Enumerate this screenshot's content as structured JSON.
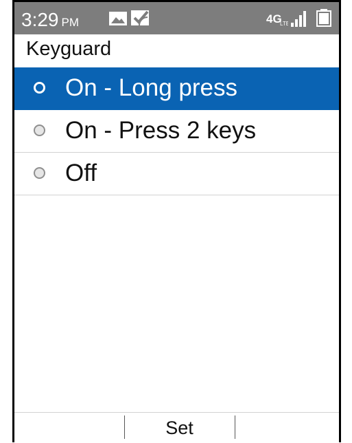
{
  "status_bar": {
    "time": "3:29",
    "ampm": "PM",
    "network_type": "4G",
    "icons": [
      "image-icon",
      "notification-check-icon",
      "4g-network-icon",
      "signal-icon",
      "battery-icon"
    ]
  },
  "screen_title": "Keyguard",
  "options": [
    {
      "label": "On - Long press",
      "selected": true
    },
    {
      "label": "On - Press 2 keys",
      "selected": false
    },
    {
      "label": "Off",
      "selected": false
    }
  ],
  "softkeys": {
    "left": "",
    "center": "Set",
    "right": ""
  },
  "colors": {
    "status_bar_bg": "#7d7d7d",
    "highlight": "#0a63b3",
    "divider": "#d2d2d2"
  }
}
